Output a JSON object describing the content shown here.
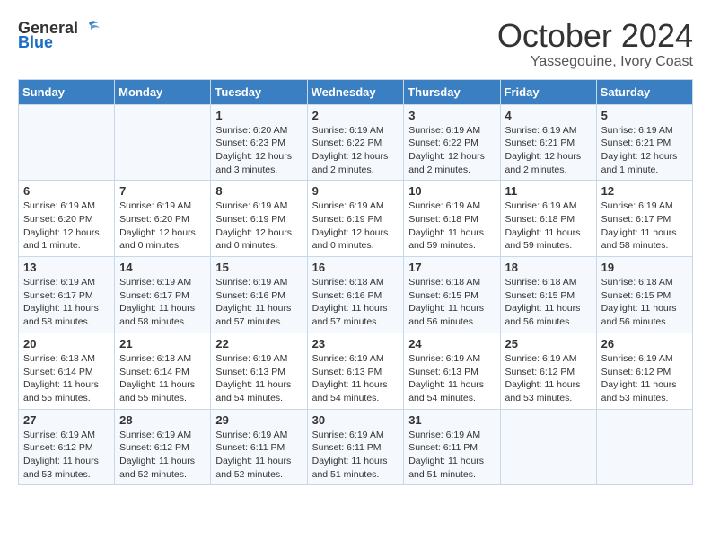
{
  "logo": {
    "text_general": "General",
    "text_blue": "Blue"
  },
  "title": "October 2024",
  "subtitle": "Yassegouine, Ivory Coast",
  "days_of_week": [
    "Sunday",
    "Monday",
    "Tuesday",
    "Wednesday",
    "Thursday",
    "Friday",
    "Saturday"
  ],
  "weeks": [
    [
      {
        "day": "",
        "sunrise": "",
        "sunset": "",
        "daylight": ""
      },
      {
        "day": "",
        "sunrise": "",
        "sunset": "",
        "daylight": ""
      },
      {
        "day": "1",
        "sunrise": "Sunrise: 6:20 AM",
        "sunset": "Sunset: 6:23 PM",
        "daylight": "Daylight: 12 hours and 3 minutes."
      },
      {
        "day": "2",
        "sunrise": "Sunrise: 6:19 AM",
        "sunset": "Sunset: 6:22 PM",
        "daylight": "Daylight: 12 hours and 2 minutes."
      },
      {
        "day": "3",
        "sunrise": "Sunrise: 6:19 AM",
        "sunset": "Sunset: 6:22 PM",
        "daylight": "Daylight: 12 hours and 2 minutes."
      },
      {
        "day": "4",
        "sunrise": "Sunrise: 6:19 AM",
        "sunset": "Sunset: 6:21 PM",
        "daylight": "Daylight: 12 hours and 2 minutes."
      },
      {
        "day": "5",
        "sunrise": "Sunrise: 6:19 AM",
        "sunset": "Sunset: 6:21 PM",
        "daylight": "Daylight: 12 hours and 1 minute."
      }
    ],
    [
      {
        "day": "6",
        "sunrise": "Sunrise: 6:19 AM",
        "sunset": "Sunset: 6:20 PM",
        "daylight": "Daylight: 12 hours and 1 minute."
      },
      {
        "day": "7",
        "sunrise": "Sunrise: 6:19 AM",
        "sunset": "Sunset: 6:20 PM",
        "daylight": "Daylight: 12 hours and 0 minutes."
      },
      {
        "day": "8",
        "sunrise": "Sunrise: 6:19 AM",
        "sunset": "Sunset: 6:19 PM",
        "daylight": "Daylight: 12 hours and 0 minutes."
      },
      {
        "day": "9",
        "sunrise": "Sunrise: 6:19 AM",
        "sunset": "Sunset: 6:19 PM",
        "daylight": "Daylight: 12 hours and 0 minutes."
      },
      {
        "day": "10",
        "sunrise": "Sunrise: 6:19 AM",
        "sunset": "Sunset: 6:18 PM",
        "daylight": "Daylight: 11 hours and 59 minutes."
      },
      {
        "day": "11",
        "sunrise": "Sunrise: 6:19 AM",
        "sunset": "Sunset: 6:18 PM",
        "daylight": "Daylight: 11 hours and 59 minutes."
      },
      {
        "day": "12",
        "sunrise": "Sunrise: 6:19 AM",
        "sunset": "Sunset: 6:17 PM",
        "daylight": "Daylight: 11 hours and 58 minutes."
      }
    ],
    [
      {
        "day": "13",
        "sunrise": "Sunrise: 6:19 AM",
        "sunset": "Sunset: 6:17 PM",
        "daylight": "Daylight: 11 hours and 58 minutes."
      },
      {
        "day": "14",
        "sunrise": "Sunrise: 6:19 AM",
        "sunset": "Sunset: 6:17 PM",
        "daylight": "Daylight: 11 hours and 58 minutes."
      },
      {
        "day": "15",
        "sunrise": "Sunrise: 6:19 AM",
        "sunset": "Sunset: 6:16 PM",
        "daylight": "Daylight: 11 hours and 57 minutes."
      },
      {
        "day": "16",
        "sunrise": "Sunrise: 6:18 AM",
        "sunset": "Sunset: 6:16 PM",
        "daylight": "Daylight: 11 hours and 57 minutes."
      },
      {
        "day": "17",
        "sunrise": "Sunrise: 6:18 AM",
        "sunset": "Sunset: 6:15 PM",
        "daylight": "Daylight: 11 hours and 56 minutes."
      },
      {
        "day": "18",
        "sunrise": "Sunrise: 6:18 AM",
        "sunset": "Sunset: 6:15 PM",
        "daylight": "Daylight: 11 hours and 56 minutes."
      },
      {
        "day": "19",
        "sunrise": "Sunrise: 6:18 AM",
        "sunset": "Sunset: 6:15 PM",
        "daylight": "Daylight: 11 hours and 56 minutes."
      }
    ],
    [
      {
        "day": "20",
        "sunrise": "Sunrise: 6:18 AM",
        "sunset": "Sunset: 6:14 PM",
        "daylight": "Daylight: 11 hours and 55 minutes."
      },
      {
        "day": "21",
        "sunrise": "Sunrise: 6:18 AM",
        "sunset": "Sunset: 6:14 PM",
        "daylight": "Daylight: 11 hours and 55 minutes."
      },
      {
        "day": "22",
        "sunrise": "Sunrise: 6:19 AM",
        "sunset": "Sunset: 6:13 PM",
        "daylight": "Daylight: 11 hours and 54 minutes."
      },
      {
        "day": "23",
        "sunrise": "Sunrise: 6:19 AM",
        "sunset": "Sunset: 6:13 PM",
        "daylight": "Daylight: 11 hours and 54 minutes."
      },
      {
        "day": "24",
        "sunrise": "Sunrise: 6:19 AM",
        "sunset": "Sunset: 6:13 PM",
        "daylight": "Daylight: 11 hours and 54 minutes."
      },
      {
        "day": "25",
        "sunrise": "Sunrise: 6:19 AM",
        "sunset": "Sunset: 6:12 PM",
        "daylight": "Daylight: 11 hours and 53 minutes."
      },
      {
        "day": "26",
        "sunrise": "Sunrise: 6:19 AM",
        "sunset": "Sunset: 6:12 PM",
        "daylight": "Daylight: 11 hours and 53 minutes."
      }
    ],
    [
      {
        "day": "27",
        "sunrise": "Sunrise: 6:19 AM",
        "sunset": "Sunset: 6:12 PM",
        "daylight": "Daylight: 11 hours and 53 minutes."
      },
      {
        "day": "28",
        "sunrise": "Sunrise: 6:19 AM",
        "sunset": "Sunset: 6:12 PM",
        "daylight": "Daylight: 11 hours and 52 minutes."
      },
      {
        "day": "29",
        "sunrise": "Sunrise: 6:19 AM",
        "sunset": "Sunset: 6:11 PM",
        "daylight": "Daylight: 11 hours and 52 minutes."
      },
      {
        "day": "30",
        "sunrise": "Sunrise: 6:19 AM",
        "sunset": "Sunset: 6:11 PM",
        "daylight": "Daylight: 11 hours and 51 minutes."
      },
      {
        "day": "31",
        "sunrise": "Sunrise: 6:19 AM",
        "sunset": "Sunset: 6:11 PM",
        "daylight": "Daylight: 11 hours and 51 minutes."
      },
      {
        "day": "",
        "sunrise": "",
        "sunset": "",
        "daylight": ""
      },
      {
        "day": "",
        "sunrise": "",
        "sunset": "",
        "daylight": ""
      }
    ]
  ]
}
